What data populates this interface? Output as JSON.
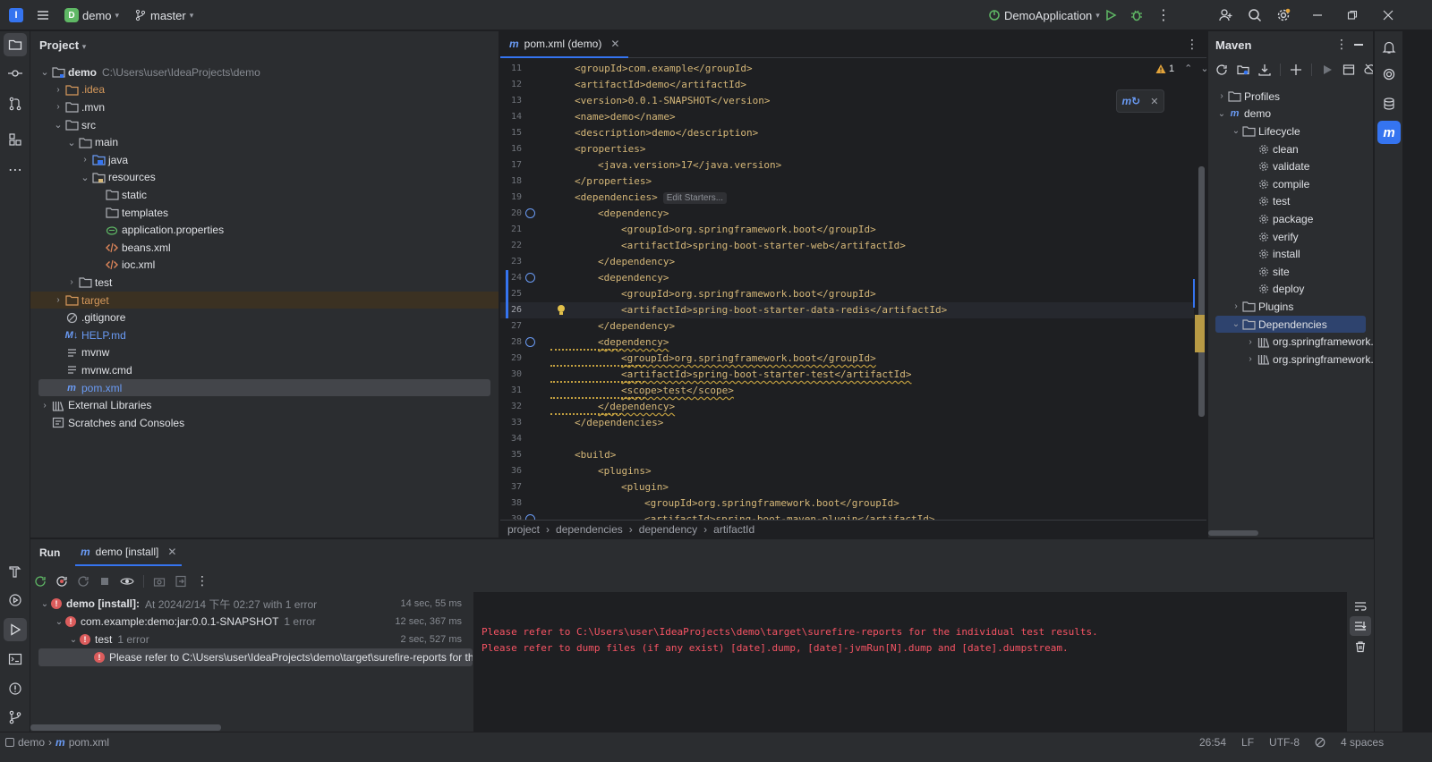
{
  "titlebar": {
    "logo_letter": "I",
    "project_badge": "D",
    "project_name": "demo",
    "branch": "master",
    "run_config": "DemoApplication"
  },
  "project_panel": {
    "title": "Project",
    "tree": [
      {
        "label": "demo",
        "extra": "C:\\Users\\user\\IdeaProjects\\demo",
        "depth": 0,
        "arrow": "down",
        "icon": "module-folder-icon"
      },
      {
        "label": ".idea",
        "depth": 1,
        "arrow": "right",
        "icon": "folder-icon",
        "color": "orange"
      },
      {
        "label": ".mvn",
        "depth": 1,
        "arrow": "right",
        "icon": "folder-icon"
      },
      {
        "label": "src",
        "depth": 1,
        "arrow": "down",
        "icon": "folder-icon"
      },
      {
        "label": "main",
        "depth": 2,
        "arrow": "down",
        "icon": "folder-icon"
      },
      {
        "label": "java",
        "depth": 3,
        "arrow": "right",
        "icon": "source-folder-icon"
      },
      {
        "label": "resources",
        "depth": 3,
        "arrow": "down",
        "icon": "resources-folder-icon"
      },
      {
        "label": "static",
        "depth": 4,
        "arrow": "",
        "icon": "folder-icon"
      },
      {
        "label": "templates",
        "depth": 4,
        "arrow": "",
        "icon": "folder-icon"
      },
      {
        "label": "application.properties",
        "depth": 4,
        "arrow": "",
        "icon": "properties-file-icon"
      },
      {
        "label": "beans.xml",
        "depth": 4,
        "arrow": "",
        "icon": "xml-file-icon"
      },
      {
        "label": "ioc.xml",
        "depth": 4,
        "arrow": "",
        "icon": "xml-file-icon"
      },
      {
        "label": "test",
        "depth": 2,
        "arrow": "right",
        "icon": "folder-icon"
      },
      {
        "label": "target",
        "depth": 1,
        "arrow": "right",
        "icon": "excluded-folder-icon",
        "color": "orange",
        "state": "excluded"
      },
      {
        "label": ".gitignore",
        "depth": 1,
        "arrow": "",
        "icon": "ignore-file-icon"
      },
      {
        "label": "HELP.md",
        "depth": 1,
        "arrow": "",
        "icon": "markdown-file-icon",
        "icon_text": "M↓",
        "color": "blue"
      },
      {
        "label": "mvnw",
        "depth": 1,
        "arrow": "",
        "icon": "text-file-icon"
      },
      {
        "label": "mvnw.cmd",
        "depth": 1,
        "arrow": "",
        "icon": "text-file-icon"
      },
      {
        "label": "pom.xml",
        "depth": 1,
        "arrow": "",
        "icon": "maven-file-icon",
        "icon_text": "m",
        "color": "blue",
        "state": "selected"
      },
      {
        "label": "External Libraries",
        "depth": 0,
        "arrow": "right",
        "icon": "library-icon"
      },
      {
        "label": "Scratches and Consoles",
        "depth": 0,
        "arrow": "",
        "icon": "scratches-icon"
      }
    ]
  },
  "editor": {
    "tab_icon": "m",
    "tab_label": "pom.xml (demo)",
    "warning_count": "1",
    "inlay_hint": "Edit Starters...",
    "current_line": "26",
    "lines": [
      {
        "n": "11",
        "indent": 1,
        "text": "<groupId>com.example</groupId>"
      },
      {
        "n": "12",
        "indent": 1,
        "text": "<artifactId>demo</artifactId>"
      },
      {
        "n": "13",
        "indent": 1,
        "text": "<version>0.0.1-SNAPSHOT</version>"
      },
      {
        "n": "14",
        "indent": 1,
        "text": "<name>demo</name>"
      },
      {
        "n": "15",
        "indent": 1,
        "text": "<description>demo</description>"
      },
      {
        "n": "16",
        "indent": 1,
        "text": "<properties>"
      },
      {
        "n": "17",
        "indent": 2,
        "text": "<java.version>17</java.version>"
      },
      {
        "n": "18",
        "indent": 1,
        "text": "</properties>"
      },
      {
        "n": "19",
        "indent": 1,
        "text": "<dependencies>",
        "inlay": true
      },
      {
        "n": "20",
        "indent": 2,
        "text": "<dependency>",
        "marker": true
      },
      {
        "n": "21",
        "indent": 3,
        "text": "<groupId>org.springframework.boot</groupId>"
      },
      {
        "n": "22",
        "indent": 3,
        "text": "<artifactId>spring-boot-starter-web</artifactId>"
      },
      {
        "n": "23",
        "indent": 2,
        "text": "</dependency>"
      },
      {
        "n": "24",
        "indent": 2,
        "text": "<dependency>",
        "marker": true,
        "changed": true
      },
      {
        "n": "25",
        "indent": 3,
        "text": "<groupId>org.springframework.boot</groupId>",
        "changed": true
      },
      {
        "n": "26",
        "indent": 3,
        "text": "<artifactId>spring-boot-starter-data-redis</artifactId>",
        "bulb": true,
        "changed": true
      },
      {
        "n": "27",
        "indent": 2,
        "text": "</dependency>"
      },
      {
        "n": "28",
        "indent": 2,
        "text": "<dependency>",
        "marker": true,
        "warn": true
      },
      {
        "n": "29",
        "indent": 3,
        "text": "<groupId>org.springframework.boot</groupId>",
        "warn": true
      },
      {
        "n": "30",
        "indent": 3,
        "text": "<artifactId>spring-boot-starter-test</artifactId>",
        "warn": true
      },
      {
        "n": "31",
        "indent": 3,
        "text": "<scope>test</scope>",
        "warn": true
      },
      {
        "n": "32",
        "indent": 2,
        "text": "</dependency>",
        "warn": true
      },
      {
        "n": "33",
        "indent": 1,
        "text": "</dependencies>"
      },
      {
        "n": "34",
        "indent": 0,
        "text": ""
      },
      {
        "n": "35",
        "indent": 1,
        "text": "<build>"
      },
      {
        "n": "36",
        "indent": 2,
        "text": "<plugins>"
      },
      {
        "n": "37",
        "indent": 3,
        "text": "<plugin>"
      },
      {
        "n": "38",
        "indent": 4,
        "text": "<groupId>org.springframework.boot</groupId>"
      },
      {
        "n": "39",
        "indent": 4,
        "text": "<artifactId>spring-boot-maven-plugin</artifactId>",
        "marker": true
      }
    ],
    "breadcrumb": [
      "project",
      "dependencies",
      "dependency",
      "artifactId"
    ]
  },
  "maven": {
    "title": "Maven",
    "tree": [
      {
        "label": "Profiles",
        "depth": 0,
        "arrow": "right",
        "icon": "folder-icon"
      },
      {
        "label": "demo",
        "depth": 0,
        "arrow": "down",
        "icon": "maven-icon",
        "icon_text": "m"
      },
      {
        "label": "Lifecycle",
        "depth": 1,
        "arrow": "down",
        "icon": "folder-icon"
      },
      {
        "label": "clean",
        "depth": 2,
        "arrow": "",
        "icon": "gear-icon"
      },
      {
        "label": "validate",
        "depth": 2,
        "arrow": "",
        "icon": "gear-icon"
      },
      {
        "label": "compile",
        "depth": 2,
        "arrow": "",
        "icon": "gear-icon"
      },
      {
        "label": "test",
        "depth": 2,
        "arrow": "",
        "icon": "gear-icon"
      },
      {
        "label": "package",
        "depth": 2,
        "arrow": "",
        "icon": "gear-icon"
      },
      {
        "label": "verify",
        "depth": 2,
        "arrow": "",
        "icon": "gear-icon"
      },
      {
        "label": "install",
        "depth": 2,
        "arrow": "",
        "icon": "gear-icon"
      },
      {
        "label": "site",
        "depth": 2,
        "arrow": "",
        "icon": "gear-icon"
      },
      {
        "label": "deploy",
        "depth": 2,
        "arrow": "",
        "icon": "gear-icon"
      },
      {
        "label": "Plugins",
        "depth": 1,
        "arrow": "right",
        "icon": "folder-icon"
      },
      {
        "label": "Dependencies",
        "depth": 1,
        "arrow": "down",
        "icon": "folder-icon",
        "state": "selected"
      },
      {
        "label": "org.springframework.b",
        "depth": 2,
        "arrow": "right",
        "icon": "library-icon"
      },
      {
        "label": "org.springframework.b",
        "depth": 2,
        "arrow": "right",
        "icon": "library-icon"
      }
    ]
  },
  "run": {
    "tab_run": "Run",
    "tab_config_icon": "m",
    "tab_config": "demo [install]",
    "tree": [
      {
        "label": "demo [install]:",
        "extra": "At 2024/2/14 下午 02:27 with 1 error",
        "time": "14 sec, 55 ms",
        "depth": 0,
        "arrow": "down",
        "bold": true
      },
      {
        "label": "com.example:demo:jar:0.0.1-SNAPSHOT",
        "extra": "1 error",
        "time": "12 sec, 367 ms",
        "depth": 1,
        "arrow": "down"
      },
      {
        "label": "test",
        "extra": "1 error",
        "time": "2 sec, 527 ms",
        "depth": 2,
        "arrow": "down"
      },
      {
        "label": "Please refer to C:\\Users\\user\\IdeaProjects\\demo\\target\\surefire-reports for the individual test results.",
        "extra": "",
        "time": "",
        "depth": 3,
        "arrow": "",
        "state": "selected"
      }
    ],
    "console": [
      "Please refer to C:\\Users\\user\\IdeaProjects\\demo\\target\\surefire-reports for the individual test results.",
      "Please refer to dump files (if any exist) [date].dump, [date]-jvmRun[N].dump and [date].dumpstream."
    ]
  },
  "statusbar": {
    "path": [
      "demo",
      "pom.xml"
    ],
    "position": "26:54",
    "line_separator": "LF",
    "encoding": "UTF-8",
    "indent": "4 spaces"
  },
  "colors": {
    "accent": "#3574f0",
    "error": "#db5c5c",
    "xml_tag": "#d5b778",
    "console_error": "#f75464"
  }
}
